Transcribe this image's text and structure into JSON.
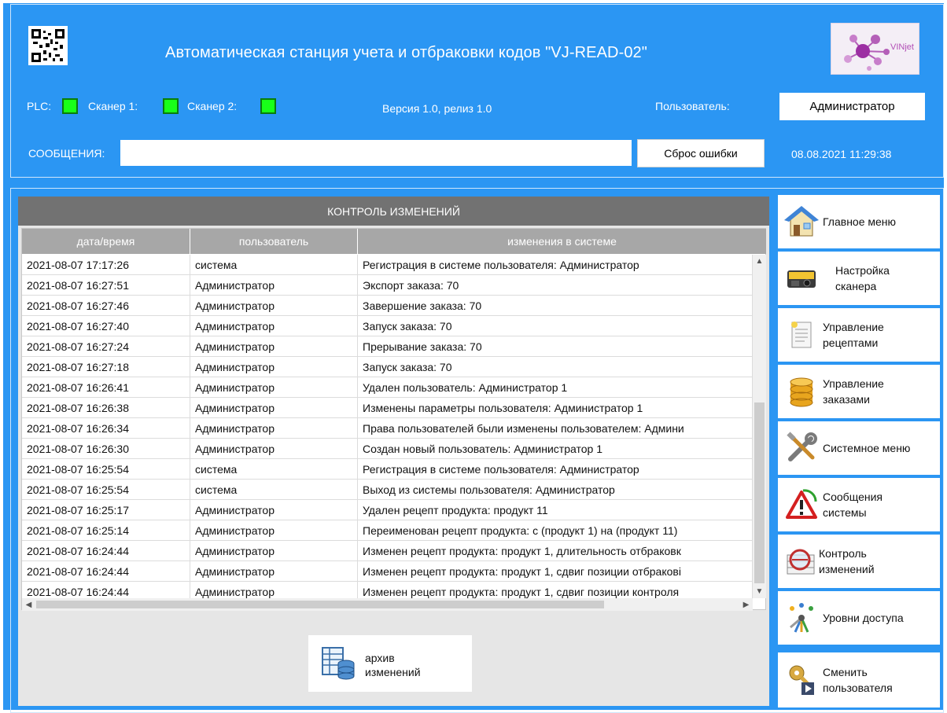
{
  "header": {
    "title": "Автоматическая станция учета и отбраковки кодов \"VJ-READ-02\"",
    "logo_text": "VINjet",
    "status": {
      "plc_label": "PLC:",
      "scanner1_label": "Сканер 1:",
      "scanner2_label": "Сканер 2:",
      "led_color": "#19ff19"
    },
    "version": "Версия 1.0, релиз 1.0",
    "user_label": "Пользователь:",
    "user_value": "Администратор",
    "messages_label": "СООБЩЕНИЯ:",
    "messages_value": "",
    "reset_button": "Сброс ошибки",
    "datetime": "08.08.2021 11:29:38"
  },
  "log": {
    "title": "КОНТРОЛЬ ИЗМЕНЕНИЙ",
    "columns": [
      "дата/время",
      "пользователь",
      "изменения в системе"
    ],
    "rows": [
      [
        "2021-08-07 17:17:26",
        "система",
        "Регистрация в системе пользователя: Администратор"
      ],
      [
        "2021-08-07 16:27:51",
        "Администратор",
        "Экспорт заказа: 70"
      ],
      [
        "2021-08-07 16:27:46",
        "Администратор",
        "Завершение заказа: 70"
      ],
      [
        "2021-08-07 16:27:40",
        "Администратор",
        "Запуск заказа: 70"
      ],
      [
        "2021-08-07 16:27:24",
        "Администратор",
        "Прерывание заказа: 70"
      ],
      [
        "2021-08-07 16:27:18",
        "Администратор",
        "Запуск заказа: 70"
      ],
      [
        "2021-08-07 16:26:41",
        "Администратор",
        "Удален пользователь: Администратор 1"
      ],
      [
        "2021-08-07 16:26:38",
        "Администратор",
        "Изменены параметры пользователя: Администратор 1"
      ],
      [
        "2021-08-07 16:26:34",
        "Администратор",
        "Права пользователей были изменены пользователем: Админи"
      ],
      [
        "2021-08-07 16:26:30",
        "Администратор",
        "Создан новый пользователь: Администратор 1"
      ],
      [
        "2021-08-07 16:25:54",
        "система",
        "Регистрация в системе пользователя: Администратор"
      ],
      [
        "2021-08-07 16:25:54",
        "система",
        "Выход из системы пользователя: Администратор"
      ],
      [
        "2021-08-07 16:25:17",
        "Администратор",
        "Удален рецепт продукта: продукт 11"
      ],
      [
        "2021-08-07 16:25:14",
        "Администратор",
        "Переименован рецепт продукта: с (продукт 1) на (продукт 11)"
      ],
      [
        "2021-08-07 16:24:44",
        "Администратор",
        "Изменен рецепт продукта: продукт 1, длительность отбраковк"
      ],
      [
        "2021-08-07 16:24:44",
        "Администратор",
        "Изменен рецепт продукта: продукт 1, сдвиг позиции отбракові"
      ],
      [
        "2021-08-07 16:24:44",
        "Администратор",
        "Изменен рецепт продукта: продукт 1, сдвиг позиции контроля"
      ]
    ],
    "archive_button": "архив\nизменений"
  },
  "menu": [
    {
      "label": "Главное меню",
      "icon": "house-icon"
    },
    {
      "label": "Настройка\nсканера",
      "icon": "scanner-icon"
    },
    {
      "label": "Управление\nрецептами",
      "icon": "document-icon"
    },
    {
      "label": "Управление\nзаказами",
      "icon": "database-icon"
    },
    {
      "label": "Системное меню",
      "icon": "tools-icon"
    },
    {
      "label": "Сообщения\nсистемы",
      "icon": "warning-icon"
    },
    {
      "label": "Контроль\nизменений",
      "icon": "magnifier-icon"
    },
    {
      "label": "Уровни доступа",
      "icon": "keys-icon"
    },
    {
      "label": "Сменить\nпользователя",
      "icon": "user-key-icon"
    }
  ]
}
